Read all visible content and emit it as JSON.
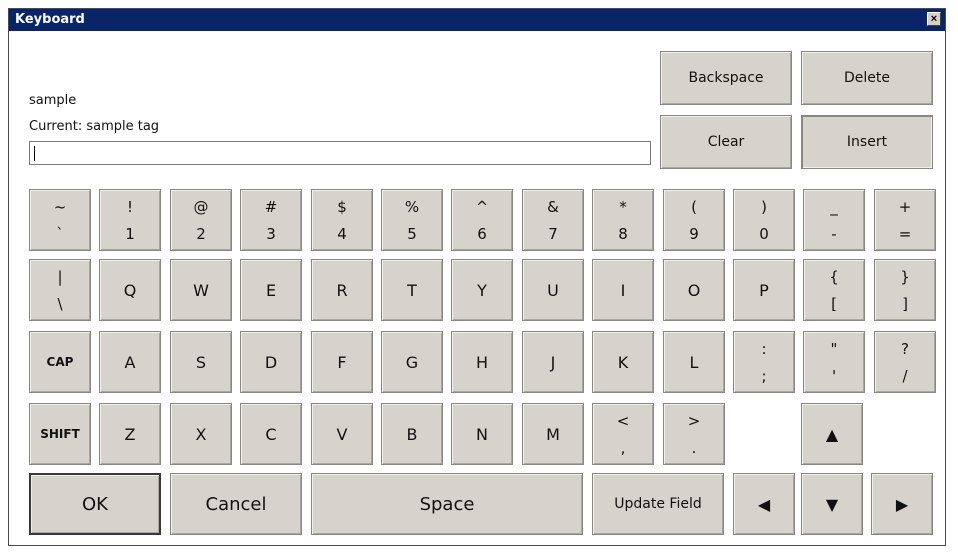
{
  "window": {
    "title": "Keyboard",
    "close_glyph": "×"
  },
  "field": {
    "label": "sample",
    "current": "Current: sample tag",
    "value": ""
  },
  "actions": {
    "backspace": "Backspace",
    "delete": "Delete",
    "clear": "Clear",
    "insert": "Insert"
  },
  "row1": [
    {
      "top": "~",
      "bot": "`"
    },
    {
      "top": "!",
      "bot": "1"
    },
    {
      "top": "@",
      "bot": "2"
    },
    {
      "top": "#",
      "bot": "3"
    },
    {
      "top": "$",
      "bot": "4"
    },
    {
      "top": "%",
      "bot": "5"
    },
    {
      "top": "^",
      "bot": "6"
    },
    {
      "top": "&",
      "bot": "7"
    },
    {
      "top": "*",
      "bot": "8"
    },
    {
      "top": "(",
      "bot": "9"
    },
    {
      "top": ")",
      "bot": "0"
    },
    {
      "top": "_",
      "bot": "-"
    },
    {
      "top": "+",
      "bot": "="
    }
  ],
  "row2": [
    {
      "top": "|",
      "bot": "\\"
    },
    {
      "label": "Q"
    },
    {
      "label": "W"
    },
    {
      "label": "E"
    },
    {
      "label": "R"
    },
    {
      "label": "T"
    },
    {
      "label": "Y"
    },
    {
      "label": "U"
    },
    {
      "label": "I"
    },
    {
      "label": "O"
    },
    {
      "label": "P"
    },
    {
      "top": "{",
      "bot": "["
    },
    {
      "top": "}",
      "bot": "]"
    }
  ],
  "row3": [
    {
      "label": "CAP"
    },
    {
      "label": "A"
    },
    {
      "label": "S"
    },
    {
      "label": "D"
    },
    {
      "label": "F"
    },
    {
      "label": "G"
    },
    {
      "label": "H"
    },
    {
      "label": "J"
    },
    {
      "label": "K"
    },
    {
      "label": "L"
    },
    {
      "top": ":",
      "bot": ";"
    },
    {
      "top": "\"",
      "bot": "'"
    },
    {
      "top": "?",
      "bot": "/"
    }
  ],
  "row4": [
    {
      "label": "SHIFT"
    },
    {
      "label": "Z"
    },
    {
      "label": "X"
    },
    {
      "label": "C"
    },
    {
      "label": "V"
    },
    {
      "label": "B"
    },
    {
      "label": "N"
    },
    {
      "label": "M"
    },
    {
      "top": "<",
      "bot": ","
    },
    {
      "top": ">",
      "bot": "."
    }
  ],
  "bottom": {
    "ok": "OK",
    "cancel": "Cancel",
    "space": "Space",
    "update": "Update Field"
  },
  "arrows": {
    "up": "▲",
    "down": "▼",
    "left": "◀",
    "right": "▶"
  }
}
